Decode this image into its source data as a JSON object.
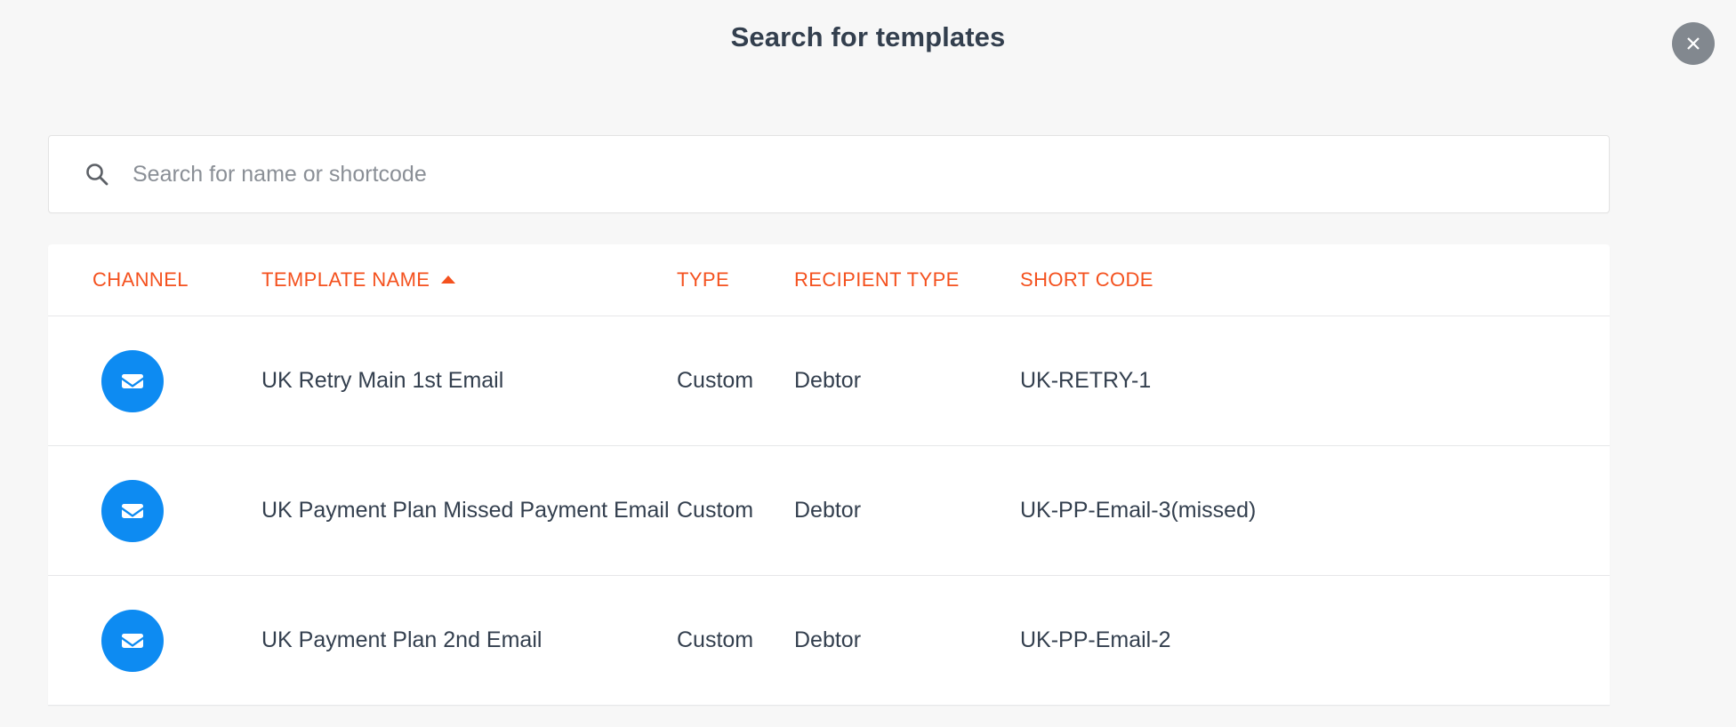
{
  "modal": {
    "title": "Search for templates",
    "close_icon": "close-circle-icon"
  },
  "search": {
    "placeholder": "Search for name or shortcode",
    "value": "",
    "icon": "search-icon"
  },
  "table": {
    "columns": [
      {
        "key": "channel",
        "label": "CHANNEL",
        "sorted": false
      },
      {
        "key": "template_name",
        "label": "TEMPLATE NAME",
        "sorted": true,
        "sort_direction": "asc",
        "sort_icon": "caret-up-icon"
      },
      {
        "key": "type",
        "label": "TYPE",
        "sorted": false
      },
      {
        "key": "recipient_type",
        "label": "RECIPIENT TYPE",
        "sorted": false
      },
      {
        "key": "short_code",
        "label": "SHORT CODE",
        "sorted": false
      }
    ],
    "rows": [
      {
        "channel_icon": "email-envelope-icon",
        "template_name": "UK Retry Main 1st Email",
        "type": "Custom",
        "recipient_type": "Debtor",
        "short_code": "UK-RETRY-1"
      },
      {
        "channel_icon": "email-envelope-icon",
        "template_name": "UK Payment Plan Missed Payment Email",
        "type": "Custom",
        "recipient_type": "Debtor",
        "short_code": "UK-PP-Email-3(missed)"
      },
      {
        "channel_icon": "email-envelope-icon",
        "template_name": "UK Payment Plan 2nd Email",
        "type": "Custom",
        "recipient_type": "Debtor",
        "short_code": "UK-PP-Email-2"
      }
    ]
  },
  "colors": {
    "page_background": "#f7f7f7",
    "title_text": "#333f4e",
    "header_accent": "#f4511e",
    "channel_badge": "#0d8bf2",
    "close_button": "#82888f",
    "body_text": "#333f4e",
    "placeholder_text": "#8a8f96",
    "row_divider": "#e6e7e9"
  }
}
